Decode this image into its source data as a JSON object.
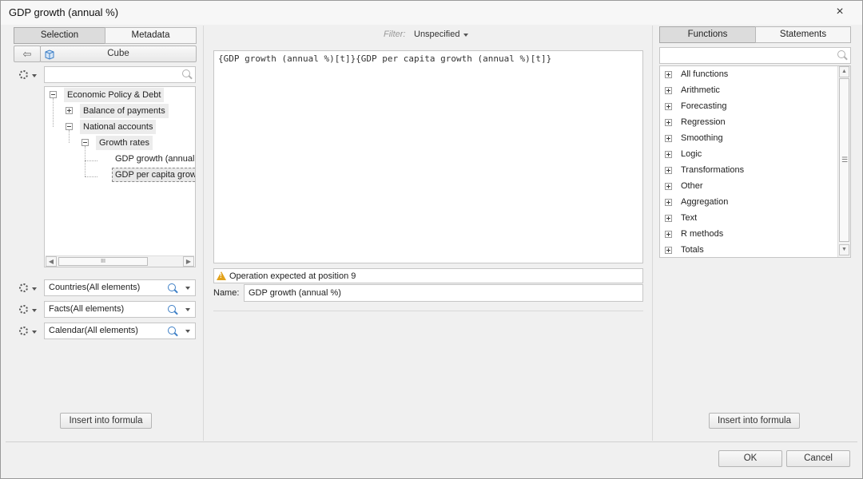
{
  "window": {
    "title": "GDP growth (annual %)",
    "close_label": "×"
  },
  "left": {
    "tabs": [
      "Selection",
      "Metadata"
    ],
    "cube_label": "Cube",
    "back_icon": "⇦",
    "search_placeholder": "",
    "tree": {
      "root": "Economic Policy & Debt",
      "child1": "Balance of payments",
      "child2": "National accounts",
      "child2a": "Growth rates",
      "leaf1": "GDP growth (annual %)",
      "leaf2": "GDP per capita growth (annual %)"
    },
    "scroll_grip": "III",
    "dimensions": [
      "Countries(All elements)",
      "Facts(All elements)",
      "Calendar(All elements)"
    ],
    "insert_label": "Insert into formula"
  },
  "middle": {
    "filter_label": "Filter:",
    "filter_value": "Unspecified",
    "formula": "{GDP growth (annual %)[t]}{GDP per capita growth (annual %)[t]}",
    "warning": "Operation expected at position 9",
    "name_label": "Name:",
    "name_value": "GDP growth (annual %)"
  },
  "right": {
    "tabs": [
      "Functions",
      "Statements"
    ],
    "search_placeholder": "",
    "functions": [
      "All functions",
      "Arithmetic",
      "Forecasting",
      "Regression",
      "Smoothing",
      "Logic",
      "Transformations",
      "Other",
      "Aggregation",
      "Text",
      "R methods",
      "Totals"
    ],
    "scroll_up": "▲",
    "scroll_down": "▼",
    "scroll_grip": "☰",
    "insert_label": "Insert into formula"
  },
  "footer": {
    "ok_label": "OK",
    "cancel_label": "Cancel"
  },
  "colors": {
    "accent": "#3d7fc6",
    "warning": "#e2a21b"
  }
}
